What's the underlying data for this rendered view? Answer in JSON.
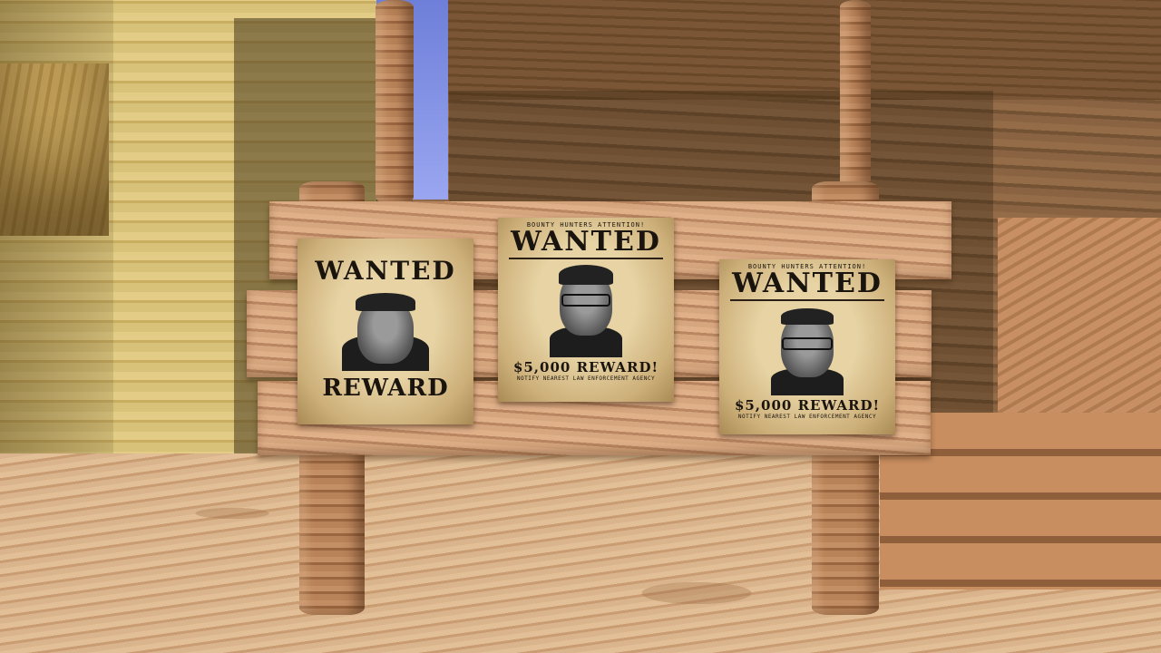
{
  "scene": {
    "description_colors": {
      "sky": "#8a96e8",
      "sand": "#d9b48c",
      "wood": "#c49066"
    }
  },
  "posters": [
    {
      "top_text": "",
      "title": "WANTED",
      "reward": "REWARD",
      "notice": ""
    },
    {
      "top_text": "BOUNTY HUNTERS ATTENTION!",
      "title": "WANTED",
      "reward": "$5,000 REWARD!",
      "notice": "NOTIFY NEAREST LAW ENFORCEMENT AGENCY"
    },
    {
      "top_text": "BOUNTY HUNTERS ATTENTION!",
      "title": "WANTED",
      "reward": "$5,000 REWARD!",
      "notice": "NOTIFY NEAREST LAW ENFORCEMENT AGENCY"
    }
  ]
}
